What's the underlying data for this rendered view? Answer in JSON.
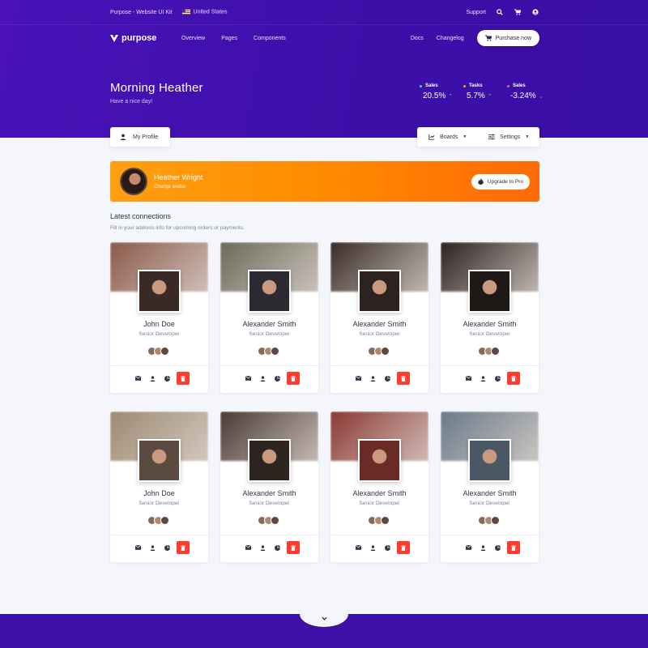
{
  "topbar": {
    "brand": "Purpose - Website UI Kit",
    "country": "United States",
    "support": "Support",
    "icons": [
      "search-icon",
      "cart-icon",
      "user-icon"
    ]
  },
  "navbar": {
    "logo": "purpose",
    "links": [
      "Overview",
      "Pages",
      "Components"
    ],
    "docs": "Docs",
    "changelog": "Changelog",
    "purchase": "Purchase now"
  },
  "greeting": {
    "title": "Morning Heather",
    "subtitle": "Have a nice day!"
  },
  "stats": [
    {
      "label": "Sales",
      "value": "20.5%",
      "trend": "up",
      "dot": "#3ee6b5"
    },
    {
      "label": "Tasks",
      "value": "5.7%",
      "trend": "up",
      "dot": "#ffa010"
    },
    {
      "label": "Sales",
      "value": "-3.24%",
      "trend": "down",
      "dot": "#ff5c7a"
    }
  ],
  "tabs": {
    "profile": "My Profile",
    "boards": "Boards",
    "settings": "Settings"
  },
  "banner": {
    "name": "Heather Wright",
    "sub": "Change avatar",
    "upgrade": "Upgrade to Pro"
  },
  "section": {
    "title": "Latest connections",
    "subtitle": "Fill in your address info for upcoming orders or payments."
  },
  "cards": [
    {
      "name": "John Doe",
      "role": "Senior Developer",
      "cover": "#8a5a4a",
      "photo": "#3a2a26"
    },
    {
      "name": "Alexander Smith",
      "role": "Senior Developer",
      "cover": "#6b6a5a",
      "photo": "#2a2a30"
    },
    {
      "name": "Alexander Smith",
      "role": "Senior Developer",
      "cover": "#3a2c28",
      "photo": "#2c2220"
    },
    {
      "name": "Alexander Smith",
      "role": "Senior Developer",
      "cover": "#2a2220",
      "photo": "#1e1816"
    },
    {
      "name": "John Doe",
      "role": "Senior Developer",
      "cover": "#9c8a72",
      "photo": "#5a4a40"
    },
    {
      "name": "Alexander Smith",
      "role": "Senior Developer",
      "cover": "#4a3a34",
      "photo": "#2e2420"
    },
    {
      "name": "Alexander Smith",
      "role": "Senior Developer",
      "cover": "#8a3a34",
      "photo": "#6a2a26"
    },
    {
      "name": "Alexander Smith",
      "role": "Senior Developer",
      "cover": "#6a7a8a",
      "photo": "#4a5866"
    }
  ],
  "colors": {
    "primary": "#4a12b8",
    "accent": "#ff8a00",
    "danger": "#ff3b30"
  }
}
